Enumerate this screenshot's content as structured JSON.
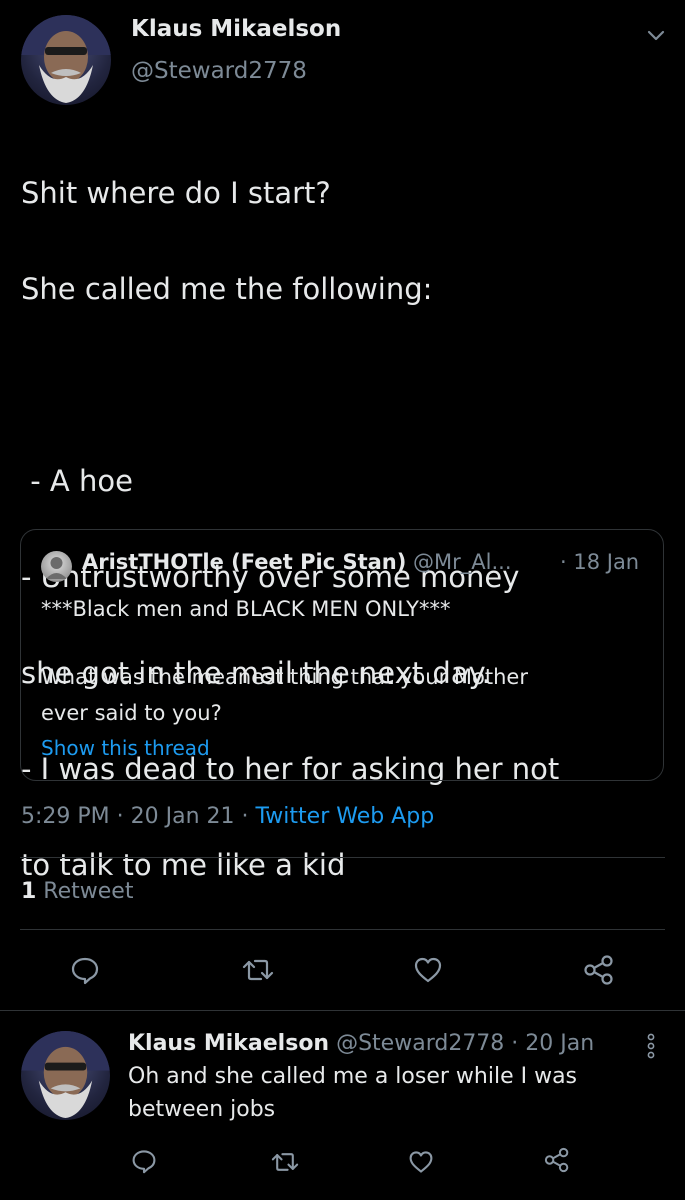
{
  "tweet": {
    "author_name": "Klaus Mikaelson",
    "author_handle": "@Steward2778",
    "lines": [
      "Shit where do I start?",
      "She called me the following:",
      "",
      " - A hoe",
      "- Untrustworthy over some money",
      "she got in the mail the next day.",
      "- I was dead to her for asking her not",
      "to talk to me like a kid"
    ],
    "quoted": {
      "author_name": "AristTHOTle (Feet Pic Stan)",
      "author_handle": "@Mr_Al...",
      "date": "· 18 Jan",
      "text_line1": "***Black men and BLACK MEN ONLY***",
      "text_line2": "What was the meanest thing that your Mother",
      "text_line3": "ever said to you?",
      "show_thread": "Show this thread"
    },
    "timestamp": "5:29 PM · 20 Jan 21 · ",
    "source": "Twitter Web App",
    "retweet_count": "1",
    "retweet_label": " Retweet"
  },
  "reply": {
    "author_name": "Klaus Mikaelson",
    "meta": "@Steward2778 · 20 Jan",
    "text_line1": "Oh and she called me a loser while I was",
    "text_line2": "between jobs"
  },
  "icons": {
    "caret": "chevron-down-icon",
    "reply": "comment-icon",
    "retweet": "retweet-icon",
    "like": "heart-icon",
    "share": "share-icon",
    "more": "more-vertical-icon"
  },
  "colors": {
    "background": "#000000",
    "text": "#e7e9ea",
    "muted": "#7d8a96",
    "link": "#1d9bf0",
    "border": "#2f3336"
  }
}
